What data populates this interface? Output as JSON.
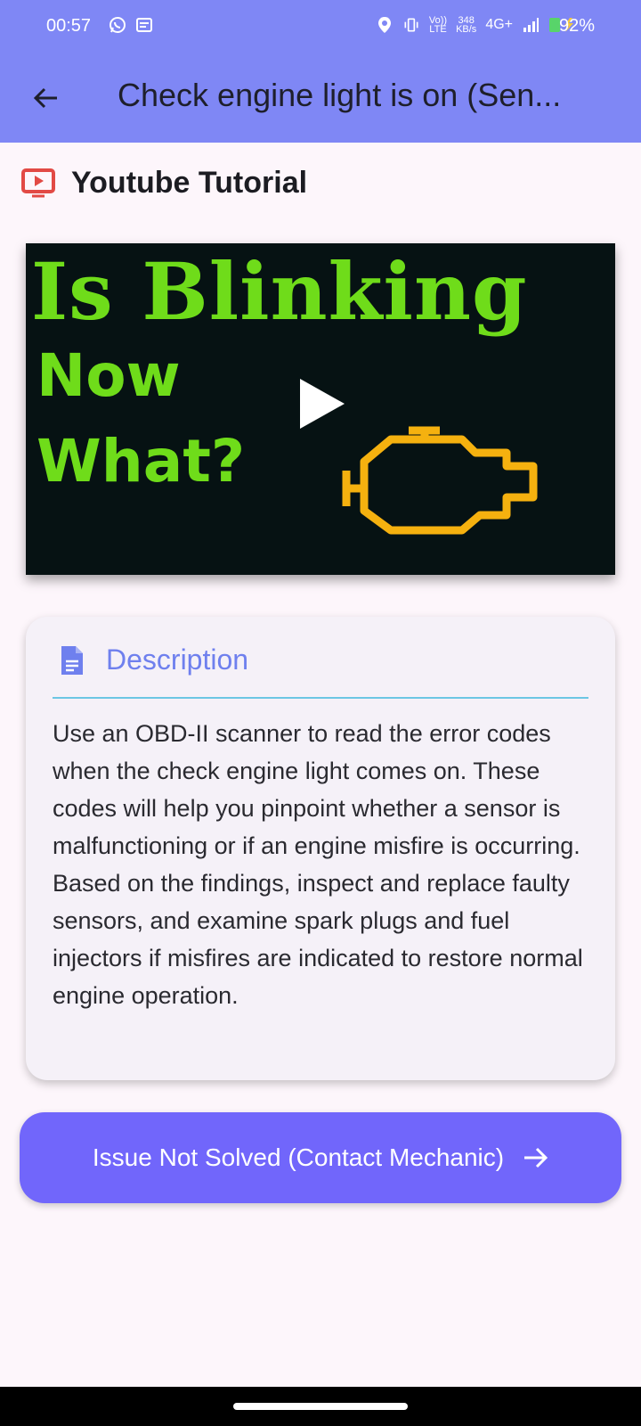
{
  "status_bar": {
    "time": "00:57",
    "network_speed": "348",
    "network_speed_unit": "KB/s",
    "volte": "Vo))",
    "lte": "LTE",
    "network_type": "4G+",
    "battery": "92%"
  },
  "app_bar": {
    "title": "Check engine light is on (Sen..."
  },
  "tutorial": {
    "title": "Youtube Tutorial",
    "thumbnail": {
      "line1": "Is Blinking",
      "line2": "Now",
      "line3": "What?"
    }
  },
  "description": {
    "title": "Description",
    "text": "Use an OBD-II scanner to read the error codes when the check engine light comes on. These codes will help you pinpoint whether a sensor is malfunctioning or if an engine misfire is occurring. Based on the findings, inspect and replace faulty sensors, and examine spark plugs and fuel injectors if misfires are indicated to restore normal engine operation."
  },
  "cta": {
    "label": "Issue Not Solved (Contact Mechanic)"
  },
  "colors": {
    "app_bar": "#7f87f5",
    "accent": "#7166fb",
    "description_title": "#6f80ee",
    "youtube_icon": "#e24a45",
    "divider": "#6cc6e4"
  }
}
